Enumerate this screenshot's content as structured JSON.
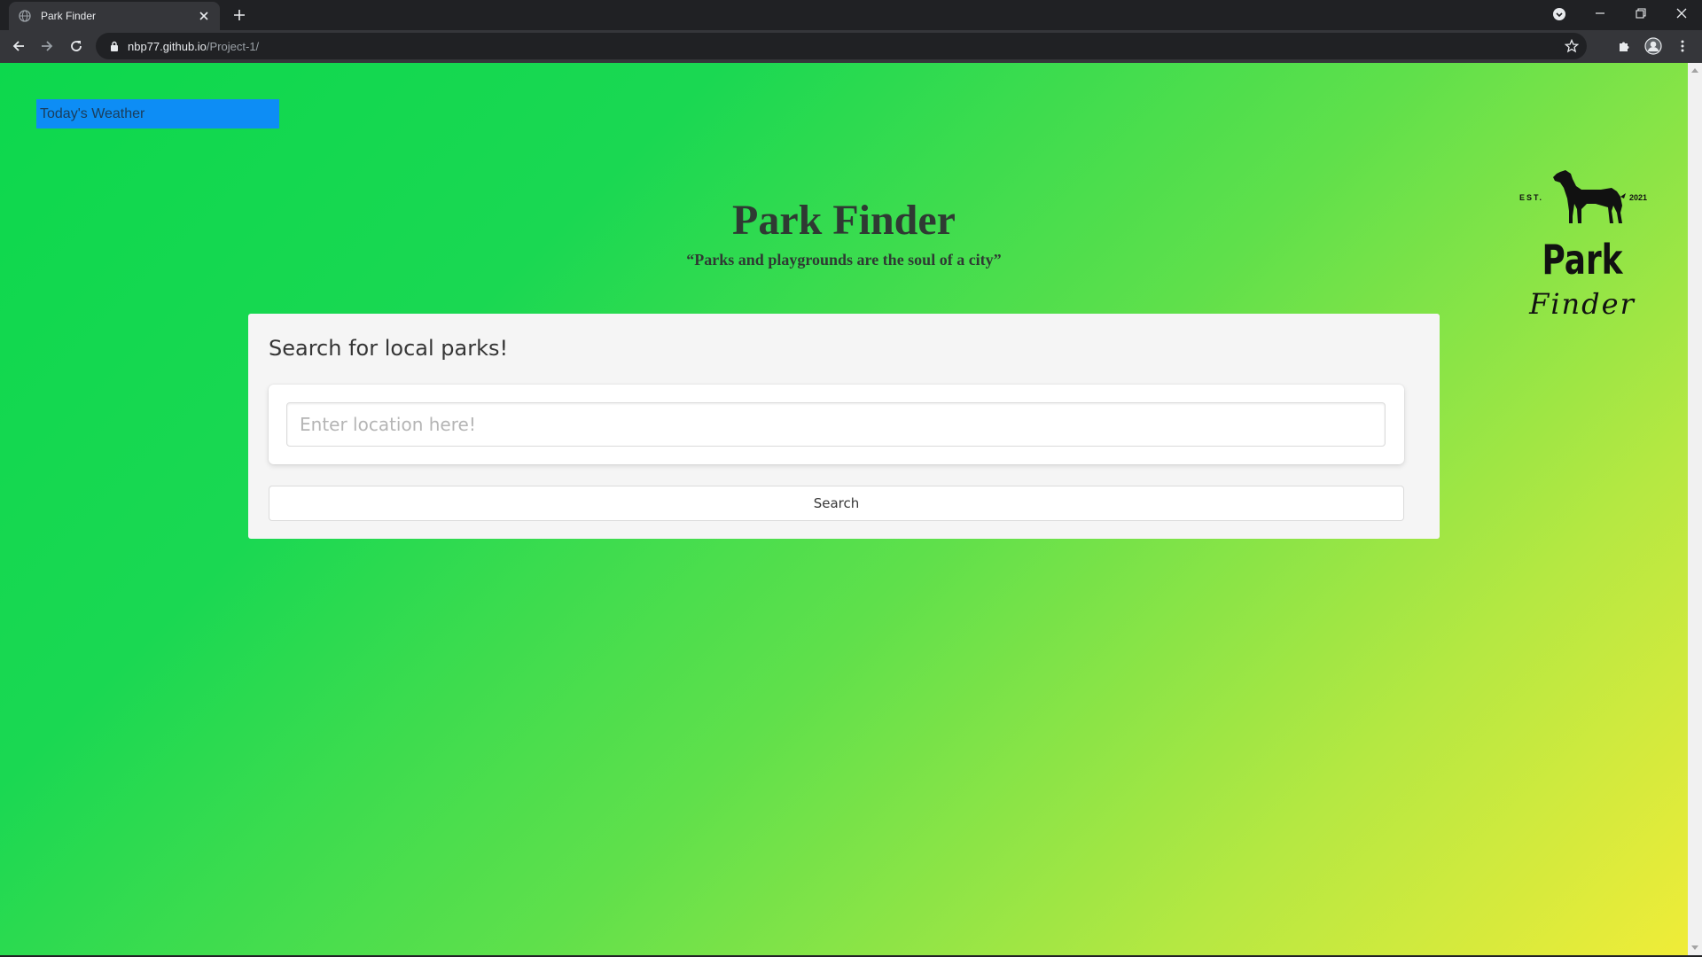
{
  "browser": {
    "tab_title": "Park Finder",
    "url_host": "nbp77.github.io",
    "url_path": "/Project-1/"
  },
  "page": {
    "weather_button": "Today's Weather",
    "title": "Park Finder",
    "quote": "“Parks and playgrounds are the soul of a city”",
    "logo": {
      "est": "EST.",
      "year": "2021",
      "park": "Park",
      "finder": "Finder"
    },
    "search_card": {
      "heading": "Search for local parks!",
      "input_placeholder": "Enter location here!",
      "input_value": "",
      "button_label": "Search"
    }
  },
  "colors": {
    "gradient_start": "#0dd84d",
    "gradient_end": "#f0ec38",
    "weather_button_bg": "#0d8df5",
    "title_text": "#2f3a33"
  },
  "icons": {
    "tab_favicon": "globe-icon",
    "tab_close": "close-icon",
    "new_tab": "plus-icon",
    "back": "arrow-left-icon",
    "forward": "arrow-right-icon",
    "reload": "reload-icon",
    "lock": "lock-icon",
    "bookmark": "star-icon",
    "extensions": "puzzle-icon",
    "profile": "profile-icon",
    "menu": "kebab-menu-icon",
    "logo": "dog-icon"
  }
}
